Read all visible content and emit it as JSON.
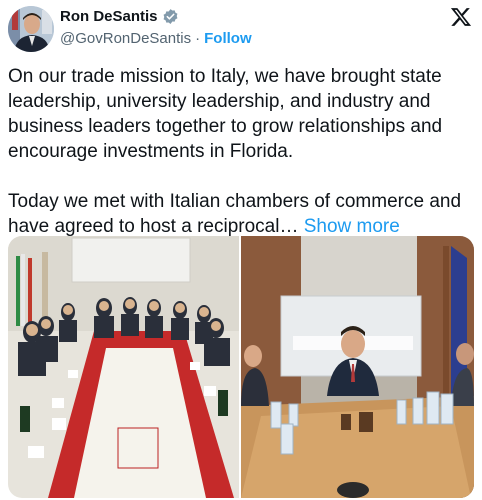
{
  "author": {
    "display_name": "Ron DeSantis",
    "handle": "@GovRonDeSantis",
    "separator": "·",
    "follow_label": "Follow",
    "verified_color": "#829aab"
  },
  "brand": {
    "logo_icon": "x-logo-icon"
  },
  "tweet": {
    "paragraph_1": "On our trade mission to Italy, we have brought state leadership, university leadership, and industry and business leaders together to grow relationships and encourage investments in Florida.",
    "paragraph_2": "Today we met with Italian chambers of commerce and have agreed to host a reciprocal…",
    "show_more_label": "Show more"
  },
  "colors": {
    "link": "#1d9bf0",
    "text": "#0f1419",
    "secondary": "#536471"
  }
}
